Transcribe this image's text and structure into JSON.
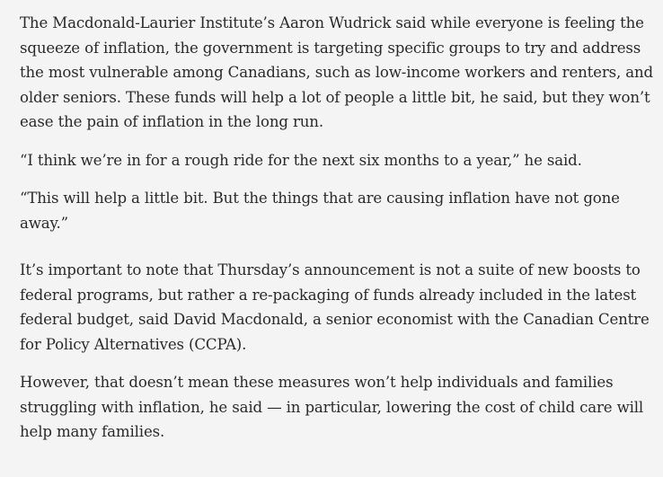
{
  "article": {
    "paragraphs": [
      "The Macdonald-Laurier Institute’s Aaron Wudrick said while everyone is feeling the squeeze of inflation, the government is targeting specific groups to try and address the most vulnerable among Canadians, such as low-income workers and renters, and older seniors. These funds will help a lot of people a little bit, he said, but they won’t ease the pain of inflation in the long run.",
      "“I think we’re in for a rough ride for the next six months to a year,” he said.",
      "“This will help a little bit. But the things that are causing inflation have not gone away.”",
      "It’s important to note that Thursday’s announcement is not a suite of new boosts to federal programs, but rather a re-packaging of funds already included in the latest federal budget, said David Macdonald, a senior economist with the Canadian Centre for Policy Alternatives (CCPA).",
      "However, that doesn’t mean these measures won’t help individuals and families struggling with inflation, he said — in particular, lowering the cost of child care will help many families."
    ]
  }
}
